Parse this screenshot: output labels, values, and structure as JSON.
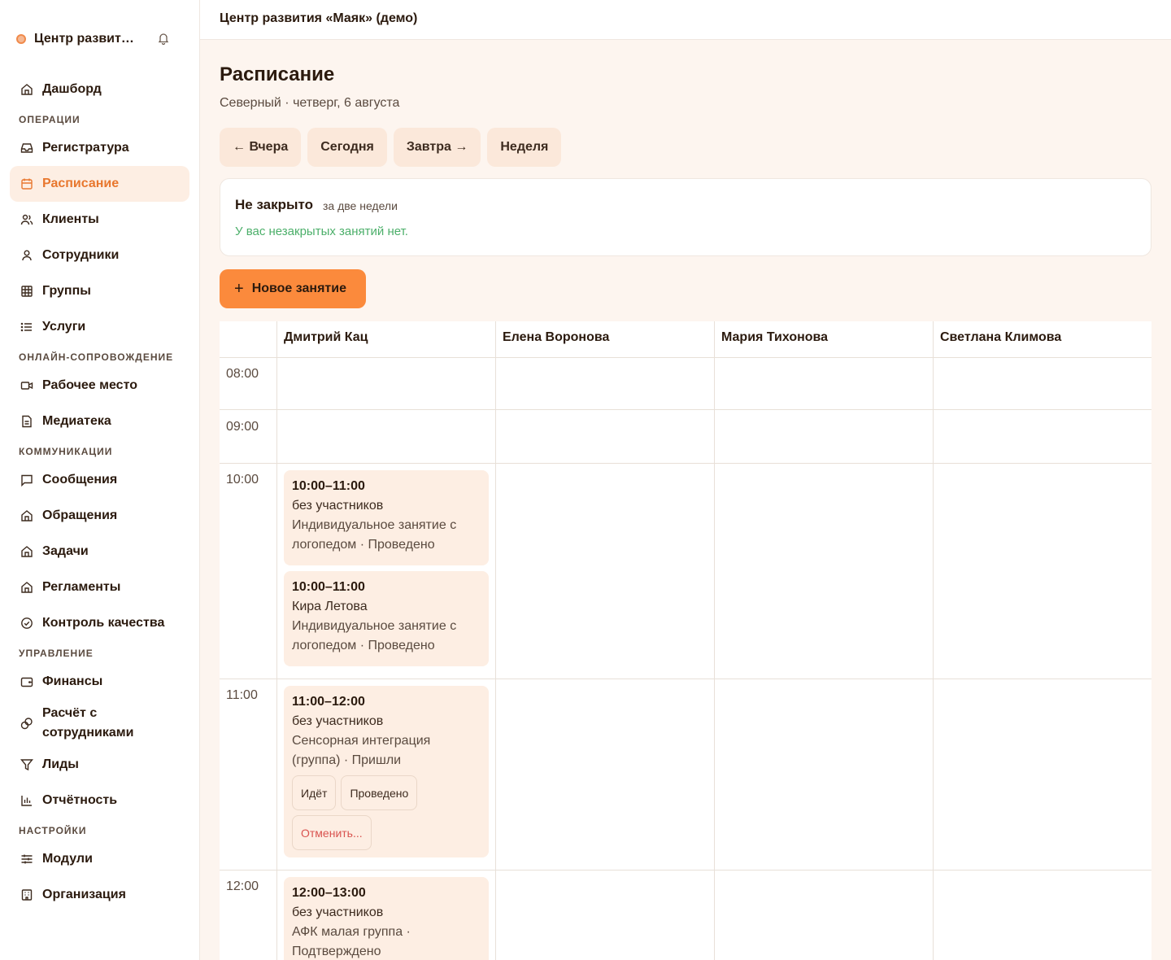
{
  "brand": {
    "name": "Центр развития «Маяк» (демо)"
  },
  "topbar": {
    "title": "Центр развития «Маяк» (демо)"
  },
  "sidebar": {
    "dashboard": "Дашборд",
    "sections": {
      "operations": "Операции",
      "online": "Онлайн-сопровождение",
      "communications": "Коммуникации",
      "management": "Управление",
      "settings": "Настройки"
    },
    "items": {
      "reception": "Регистратура",
      "schedule": "Расписание",
      "clients": "Клиенты",
      "staff": "Сотрудники",
      "groups": "Группы",
      "services": "Услуги",
      "workspace": "Рабочее место",
      "media": "Медиатека",
      "messages": "Сообщения",
      "requests": "Обращения",
      "tasks": "Задачи",
      "regulations": "Регламенты",
      "quality": "Контроль качества",
      "finance": "Финансы",
      "payroll": "Расчёт с сотрудниками",
      "leads": "Лиды",
      "reports": "Отчётность",
      "modules": "Модули",
      "organization": "Организация"
    },
    "active": "schedule"
  },
  "page": {
    "title": "Расписание",
    "subtitle": "Северный · четверг, 6 августа"
  },
  "day_nav": {
    "prev": "← Вчера",
    "today": "Сегодня",
    "next": "Завтра →",
    "week": "Неделя"
  },
  "unclosed": {
    "title": "Не закрыто",
    "period": "за две недели",
    "message": "У вас незакрытых занятий нет."
  },
  "new_lesson": {
    "label": "Новое занятие"
  },
  "schedule": {
    "staff": [
      "Дмитрий Кац",
      "Елена Воронова",
      "Мария Тихонова",
      "Светлана Климова"
    ],
    "hours": [
      "08:00",
      "09:00",
      "10:00",
      "11:00",
      "12:00"
    ],
    "events": [
      {
        "time": "10:00–11:00",
        "client": "без участников",
        "desc": "Индивидуальное занятие с логопедом · Проведено"
      },
      {
        "time": "10:00–11:00",
        "client": "Кира Летова",
        "desc": "Индивидуальное занятие с логопедом · Проведено"
      },
      {
        "time": "11:00–12:00",
        "client": "без участников",
        "desc": "Сенсорная интеграция (группа) · Пришли",
        "actions": {
          "ongoing": "Идёт",
          "done": "Проведено",
          "cancel": "Отменить..."
        }
      },
      {
        "time": "12:00–13:00",
        "client": "без участников",
        "desc": "АФК малая группа · Подтверждено"
      }
    ]
  },
  "colors": {
    "accent": "#e8772e",
    "button_primary": "#fb8a3c",
    "event_bg": "#fdeee3",
    "success_text": "#4caf6a",
    "danger_text": "#d9534f"
  }
}
